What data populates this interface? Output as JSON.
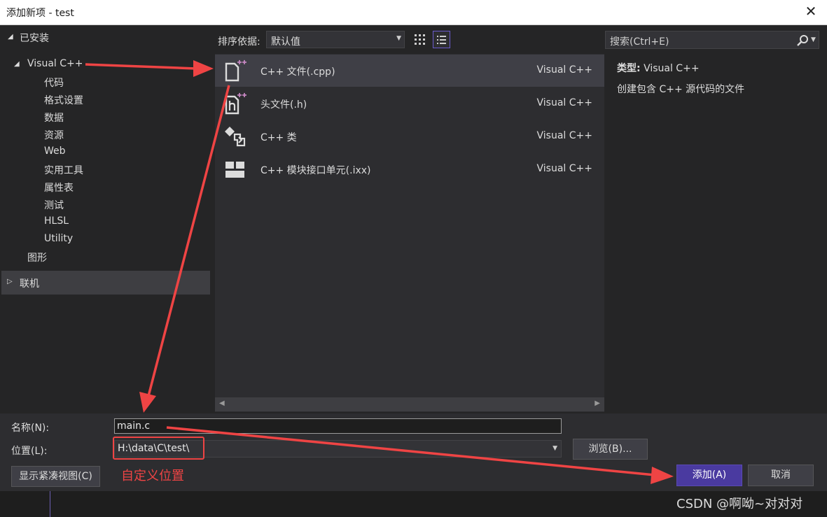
{
  "window": {
    "title": "添加新项 - test",
    "close": "✕"
  },
  "left": {
    "installed": "已安装",
    "visual_cpp": "Visual C++",
    "children": [
      "代码",
      "格式设置",
      "数据",
      "资源",
      "Web",
      "实用工具",
      "属性表",
      "测试",
      "HLSL",
      "Utility"
    ],
    "graphics": "图形",
    "online": "联机"
  },
  "toolbar": {
    "sort_label": "排序依据:",
    "sort_value": "默认值"
  },
  "templates": [
    {
      "name": "C++ 文件(.cpp)",
      "category": "Visual C++",
      "icon": "cpp-file-icon",
      "selected": true
    },
    {
      "name": "头文件(.h)",
      "category": "Visual C++",
      "icon": "header-file-icon",
      "selected": false
    },
    {
      "name": "C++ 类",
      "category": "Visual C++",
      "icon": "cpp-class-icon",
      "selected": false
    },
    {
      "name": "C++ 模块接口单元(.ixx)",
      "category": "Visual C++",
      "icon": "module-interface-icon",
      "selected": false
    }
  ],
  "search": {
    "placeholder": "搜索(Ctrl+E)"
  },
  "details": {
    "type_label": "类型:",
    "type_value": "Visual C++",
    "description": "创建包含 C++ 源代码的文件"
  },
  "form": {
    "name_label": "名称(N):",
    "name_value": "main.c",
    "location_label": "位置(L):",
    "location_value": "H:\\data\\C\\test\\",
    "browse": "浏览(B)...",
    "compact": "显示紧凑视图(C)",
    "add": "添加(A)",
    "cancel": "取消"
  },
  "annotation": {
    "text": "自定义位置",
    "color": "#ef4444"
  },
  "watermark": "CSDN @啊呦~对对对",
  "colors": {
    "accent": "#4a3aa0",
    "annotation_red": "#ef4444",
    "background": "#252526"
  }
}
